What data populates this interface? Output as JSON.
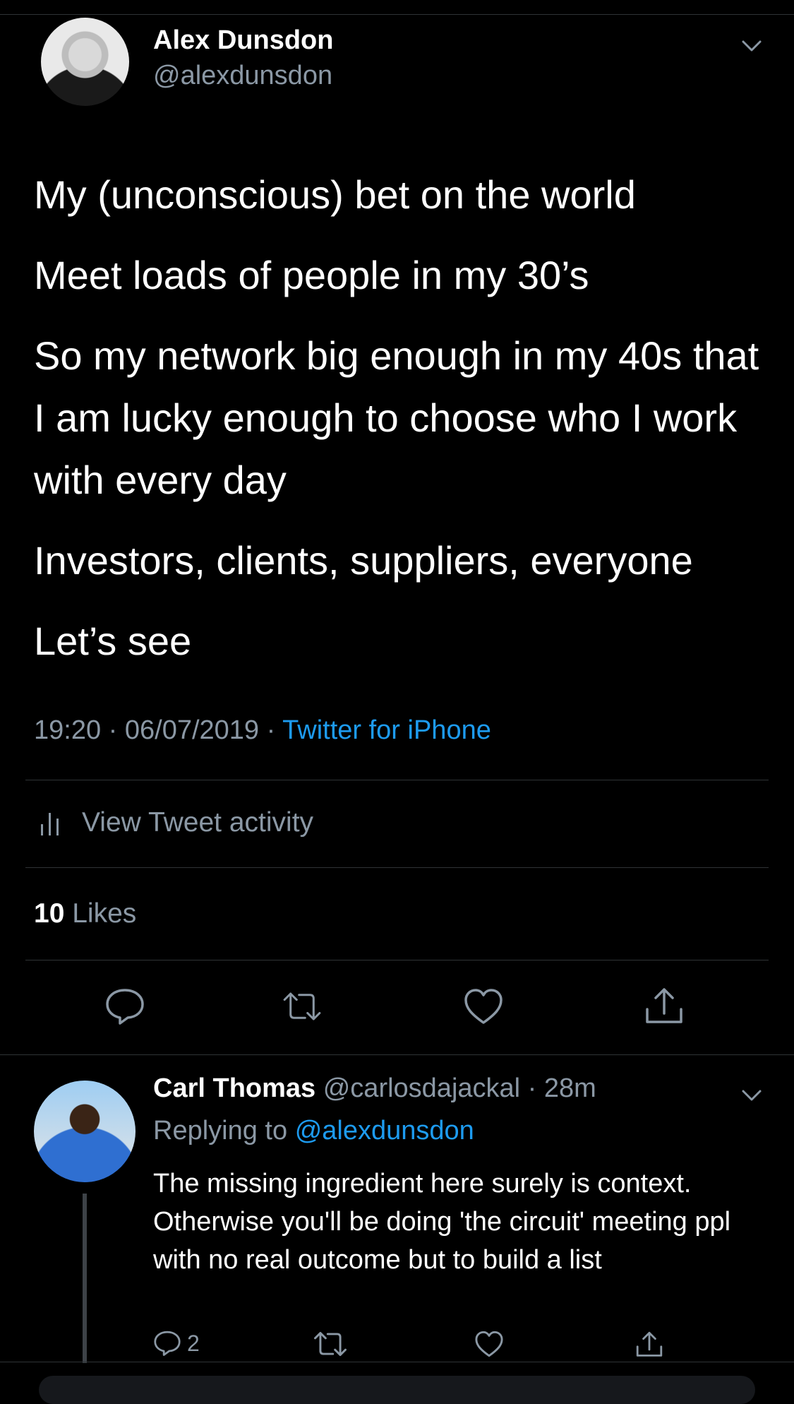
{
  "tweet": {
    "author_name": "Alex Dunsdon",
    "author_handle": "@alexdunsdon",
    "paragraphs": [
      "My (unconscious) bet on the world",
      "Meet loads of people in my 30’s",
      "So my network big enough in my 40s that I am lucky enough to choose who I work with every day",
      "Investors, clients, suppliers, everyone",
      "Let’s see"
    ],
    "time": "19:20",
    "date": "06/07/2019",
    "source": "Twitter for iPhone",
    "activity_label": "View Tweet activity",
    "likes_count": "10",
    "likes_label": "Likes"
  },
  "reply": {
    "name": "Carl Thomas",
    "handle": "@carlosdajackal",
    "age": "28m",
    "replying_prefix": "Replying to",
    "replying_to": "@alexdunsdon",
    "text": "The missing ingredient here surely is context. Otherwise you'll be doing 'the circuit' meeting ppl with no real outcome but to build a list",
    "reply_count": "2"
  },
  "icons": {
    "reply": "reply-icon",
    "retweet": "retweet-icon",
    "like": "heart-icon",
    "share": "share-icon",
    "chevron": "chevron-down-icon",
    "activity": "bar-chart-icon"
  },
  "colors": {
    "background": "#000000",
    "text": "#ffffff",
    "secondary": "#8b98a5",
    "accent": "#1d9bf0",
    "divider": "#2f3336"
  }
}
